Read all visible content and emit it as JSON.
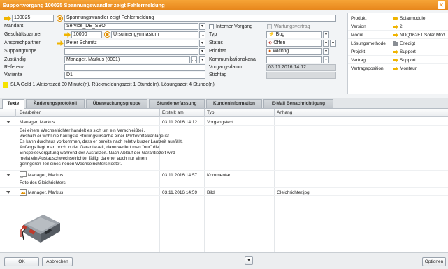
{
  "window": {
    "title": "Supportvorgang 100025 Spannungswandler zeigt Fehlermeldung",
    "close_icon": "close-icon"
  },
  "header": {
    "id_value": "100025",
    "subject_value": "Spannungswandler zeigt Fehlermeldung"
  },
  "form": {
    "mandant_label": "Mandant",
    "mandant_value": "Service_DE_SBO",
    "interner_label": "Interner Vorgang",
    "wartung_label": "Wartungsvertrag",
    "geschaeft_label": "Geschäftspartner",
    "geschaeft_id": "10000",
    "geschaeft_name": "Ursulinengymnasium",
    "typ_label": "Typ",
    "typ_value": "Bug",
    "ansprech_label": "Ansprechpartner",
    "ansprech_value": "Peter Schmitz",
    "status_label": "Status",
    "status_value": "Offen",
    "supportgruppe_label": "Supportgruppe",
    "supportgruppe_value": "",
    "prioritaet_label": "Priorität",
    "prioritaet_value": "Wichtig",
    "zustaendig_label": "Zuständig",
    "zustaendig_value": "Manager, Markus (0001)",
    "kommunikation_label": "Kommunikationskanal",
    "kommunikation_value": "",
    "referenz_label": "Referenz",
    "referenz_value": "",
    "vorgangsdatum_label": "Vorgangsdatum",
    "vorgangsdatum_value": "03.11.2016 14:12",
    "variante_label": "Variante",
    "variante_value": "D1",
    "stichtag_label": "Stichtag",
    "stichtag_value": ""
  },
  "right_panel": [
    {
      "key": "Produkt",
      "value": "Solarmodule",
      "icon": "arrow-right-icon"
    },
    {
      "key": "Version",
      "value": "2",
      "icon": "arrow-right-icon"
    },
    {
      "key": "Modul",
      "value": "NDQ162E1 Solar Mod",
      "icon": "arrow-right-icon"
    },
    {
      "key": "Lösungsmethode",
      "value": "Erledigt",
      "icon": "folder-icon"
    },
    {
      "key": "Projekt",
      "value": "Support",
      "icon": "arrow-right-icon"
    },
    {
      "key": "Vertrag",
      "value": "Support",
      "icon": "arrow-right-icon"
    },
    {
      "key": "Vertragsposition",
      "value": "Monteur",
      "icon": "arrow-right-icon"
    }
  ],
  "sla_text": "SLA Gold 1.Aktionszeit 30 Minute(n), Rückmeldungszeit 1 Stunde(n), Lösungszeit 4 Stunde(n)",
  "tabs": [
    "Texte",
    "Änderungsprotokoll",
    "Überwachungsgruppe",
    "Stundenerfassung",
    "Kundeninformation",
    "E-Mail Benachrichtigung"
  ],
  "grid": {
    "columns": [
      "Bearbeiter",
      "Erstellt am",
      "Typ",
      "Anhang"
    ],
    "rows": [
      {
        "bearbeiter": "Manager, Markus",
        "erstellt": "03.11.2016 14:12",
        "typ": "Vorgangstext",
        "anhang": "",
        "body": [
          "Bei einem Wechselrichter handelt es sich um ein Verschleißteil,",
          "weshalb er wohl die häufigste Störungsursache einer Photovoltaikanlage ist.",
          "Es kann durchaus vorkommen, dass er bereits nach relativ kurzer Laufzeit ausfällt.",
          "Anfangs liegt man noch in der Garantiezeit, dann verliert man \"nur\" die",
          "Einspeisevergütung während der Ausfallzeit. Nach Ablauf der Garantiezeit wird",
          "meist ein Austauschwechselrichter fällig, da eher auch nur einen",
          "geringeren Teil eines neuen Wechselrichters kostet."
        ]
      },
      {
        "bearbeiter": "Manager, Markus",
        "erstellt": "03.11.2016 14:57",
        "typ": "Kommentar",
        "anhang": "",
        "body": [
          "Foto des Gleichrichters"
        ]
      },
      {
        "bearbeiter": "Manager, Markus",
        "erstellt": "03.11.2016 14:59",
        "typ": "Bild",
        "anhang": "Gleichrichter.jpg",
        "body": []
      }
    ]
  },
  "buttons": {
    "ok": "OK",
    "cancel": "Abbrechen",
    "options": "Optionen"
  }
}
